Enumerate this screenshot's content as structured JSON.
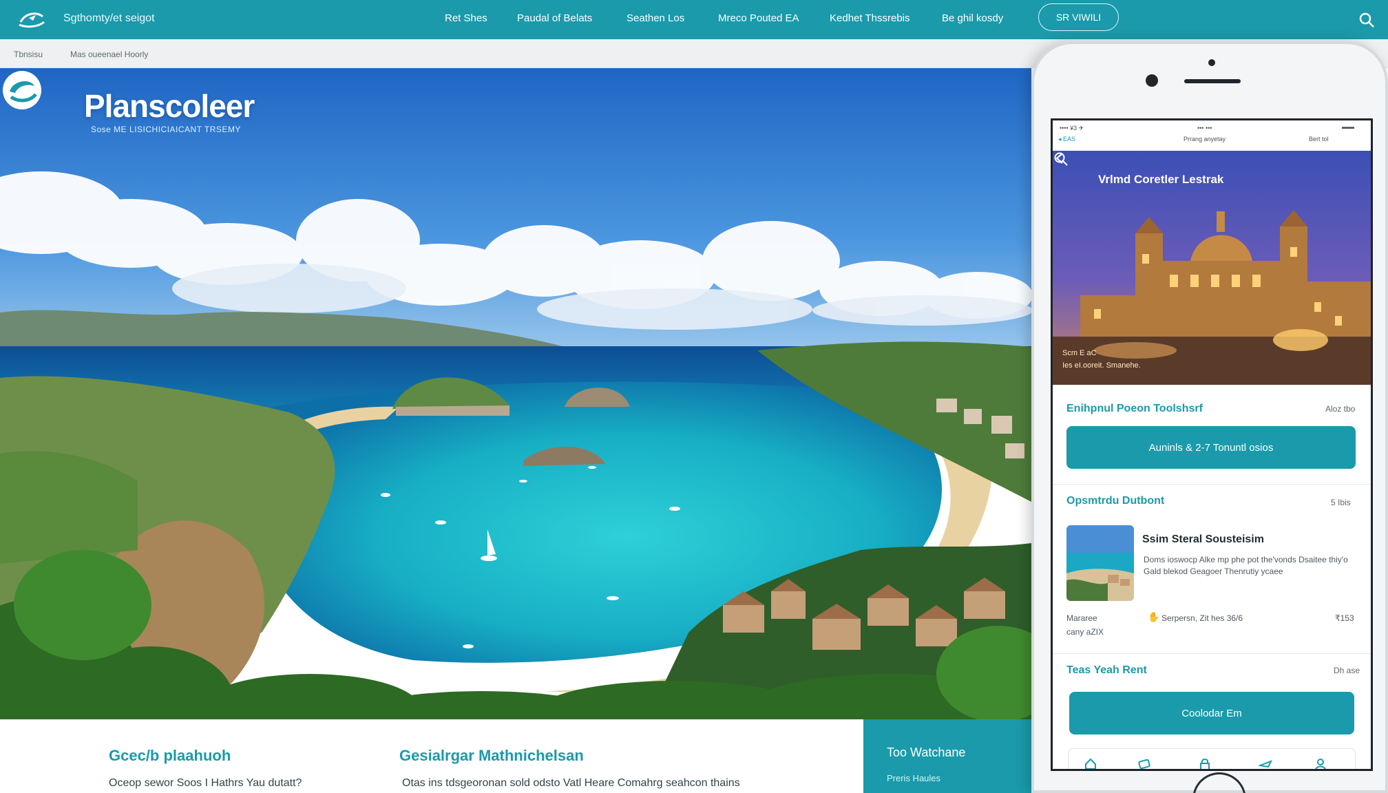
{
  "nav": {
    "brand_text": "Sgthomty/et seigot",
    "items": [
      "Ret Shes",
      "Paudal of Belats",
      "Seathen Los",
      "Mreco Pouted EA",
      "Kedhet Thssrebis",
      "Be ghil kosdy"
    ],
    "cta_label": "SR VIWILI"
  },
  "breadcrumb": {
    "item1": "Tbnsisu",
    "item2": "Mas oueenael Hoorly"
  },
  "hero": {
    "brand_name": "Planscoleer",
    "tagline": "Sose ME LISICHICIAICANT TRSEMY"
  },
  "features": [
    {
      "title": "Gcec/b plaahuoh",
      "text": "Oceop sewor Soos I Hathrs Yau dutatt?"
    },
    {
      "title": "Gesialrgar Mathnichelsan",
      "text": "Otas ins tdsgeoronan sold odsto Vatl Heare Comahrg seahcon thains"
    }
  ],
  "teal_panel": {
    "title": "Too Watchane",
    "subtitle": "Preris Haules"
  },
  "phone": {
    "status": {
      "left": "•••• ¥3 ✈",
      "center": "••• •••",
      "bars": "▬▬",
      "back_label": "◂ EAS",
      "sub_center": "Prrang anyetay",
      "sub_right": "Bert tol"
    },
    "header_title": "Vrlmd Coretler Lestrak",
    "image_caption1": "Scm E aC",
    "image_caption2": "Ies eI.ooreit. Smanehe.",
    "section1": {
      "label": "Enihpnul Poeon Toolshsrf",
      "meta": "Aloz tbo"
    },
    "button1": "Auninls & 2-7 Tonuntl osios",
    "section2": {
      "label": "Opsmtrdu Dutbont",
      "meta": "5 Ibis"
    },
    "card": {
      "title": "Ssim Steral Sousteisim",
      "desc": "Doms ioswocp Alke mp phe pot the'vonds Dsaitee thiy'o Gald blekod Geagoer Thenrutiy ycaee",
      "meta1": "Mararee",
      "meta2": "cany aZIX",
      "date": "Serpersn, Zit hes 36/6",
      "price": "₹153"
    },
    "section3": {
      "label": "Teas Yeah Rent",
      "meta": "Dh ase"
    },
    "button2": "Coolodar Em"
  },
  "colors": {
    "brand_teal": "#1a9aaa",
    "nav_bar": "#1a9aaa",
    "sky": "#2f7fd4",
    "sea": "#1fb7c8"
  },
  "icons": [
    "plane-logo-icon",
    "search-icon",
    "back-arrow-icon",
    "phone-search-icon",
    "star-icon",
    "tab-home-icon",
    "tab-ticket-icon",
    "tab-lock-icon",
    "tab-plane-icon",
    "tab-user-icon"
  ]
}
